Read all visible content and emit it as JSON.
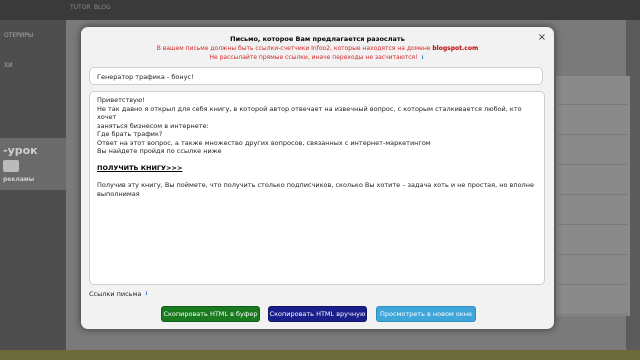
{
  "background": {
    "topbar_items": [
      "TUTOR",
      "BLOG"
    ],
    "sidebar_labels": [
      "ОТЕРИРЫ",
      "ХИ"
    ],
    "promo_title": "-урок",
    "promo_text": "рекламы"
  },
  "modal": {
    "title": "Письмо, которое Вам предлагается разослать",
    "warning_line1_prefix": "В вашем письме должны быть ссылки-счетчики Infoo2, которые находятся на домене ",
    "warning_domain": "blogspot.com",
    "warning_line2": "Не рассылайте прямые ссылки, иначе переходы не засчитаются!",
    "close_label": "×",
    "subject": "Генератор трафика - бонус!",
    "body": {
      "greeting": "Приветствую!",
      "line1": "Не так давно я открыл для себя книгу, в которой автор отвечает на извечный вопрос, с которым сталкивается любой, кто хочет",
      "line2": "заняться бизнесом в интернете:",
      "line3": "Где брать трафик?",
      "line4": "Ответ на этот вопрос, а также множество других вопросов, связанных с интернет-маркетингом",
      "line5": "Вы найдете пройдя по ссылке ниже",
      "link": "ПОЛУЧИТЬ КНИГУ>>>",
      "line6": "Получив эту книгу, Вы поймете, что получить столько подписчиков, сколько Вы хотите – задача хоть и не простая, но вполне",
      "line7": "выполнимая"
    },
    "links_label": "Ссылки письма",
    "buttons": {
      "copy_html": "Скопировать HTML в буфер",
      "copy_manual": "Скопировать HTML вручную",
      "preview": "Просмотреть в новом окне"
    }
  },
  "colors": {
    "copy_button": "#1a7a1f",
    "manual_button": "#1b1f8c",
    "preview_button": "#3fa6d9",
    "warning_text": "#d42a2a"
  }
}
